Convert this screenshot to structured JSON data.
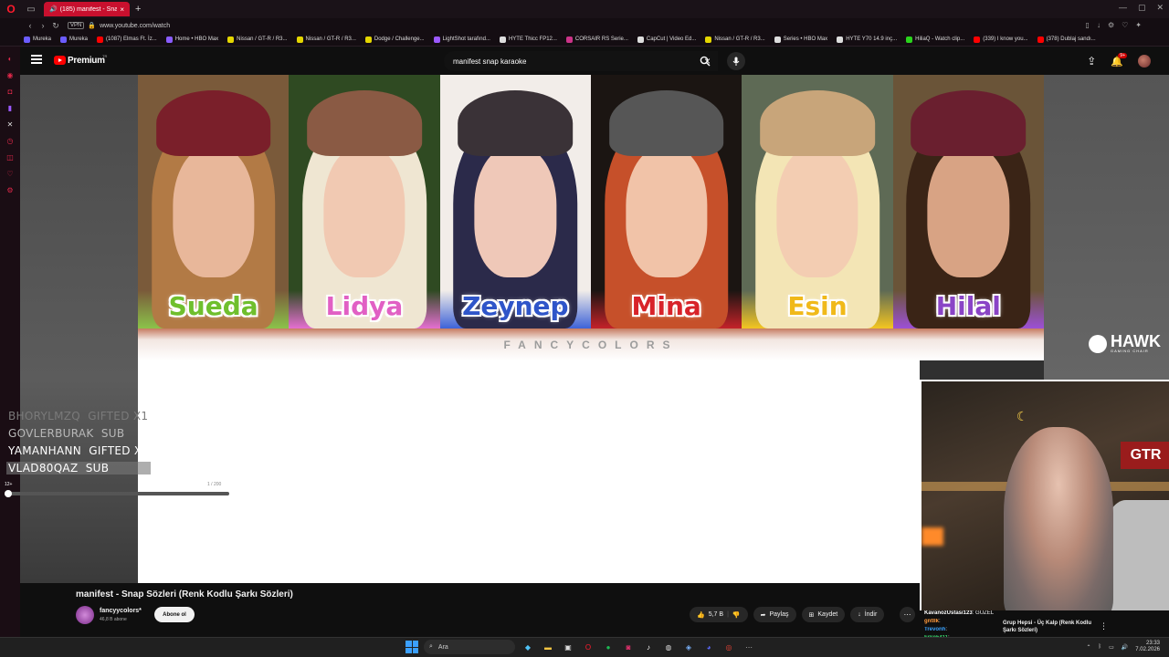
{
  "browser": {
    "tab_title": "(185) manifest - Snap",
    "vpn_label": "VPN",
    "url": "www.youtube.com/watch",
    "bookmarks": [
      {
        "label": "Mureka",
        "color": "#6b5cff"
      },
      {
        "label": "Mureka",
        "color": "#6b5cff"
      },
      {
        "label": "(1087) Elmas Ft. İz...",
        "color": "#ff0000"
      },
      {
        "label": "Home • HBO Max",
        "color": "#8a5cff"
      },
      {
        "label": "Nissan / GT-R / R3...",
        "color": "#e4d600"
      },
      {
        "label": "Nissan / GT-R / R3...",
        "color": "#e4d600"
      },
      {
        "label": "Dodge / Challenge...",
        "color": "#e4d600"
      },
      {
        "label": "LightShot tarafınd...",
        "color": "#9b59ff"
      },
      {
        "label": "HYTE Thicc FP12...",
        "color": "#dddddd"
      },
      {
        "label": "CORSAIR RS Serie...",
        "color": "#cc3388"
      },
      {
        "label": "CapCut | Video Ed...",
        "color": "#dddddd"
      },
      {
        "label": "Nissan / GT-R / R3...",
        "color": "#e4d600"
      },
      {
        "label": "Series • HBO Max",
        "color": "#dddddd"
      },
      {
        "label": "HYTE Y70 14.9 inç...",
        "color": "#dddddd"
      },
      {
        "label": "HiliaQ - Watch clip...",
        "color": "#2ad31c"
      },
      {
        "label": "(339) I know you...",
        "color": "#ff0000"
      },
      {
        "label": "(378) Dublaj sandı...",
        "color": "#ff0000"
      }
    ]
  },
  "youtube": {
    "brand": "Premium",
    "brand_sup": "TR",
    "search_value": "manifest snap karaoke",
    "notification_count": "9+"
  },
  "video": {
    "panels": [
      {
        "name": "Sueda",
        "name_color": "#6fbf2d",
        "bg": "#7a5a3a",
        "hat": "#7a1f2a",
        "hair": "#b27a45",
        "face": "#e8b79a",
        "band": "#8bc34a"
      },
      {
        "name": "Lidya",
        "name_color": "#e160c4",
        "bg": "#2f4a22",
        "hat": "#8a5a44",
        "hair": "#efe6d2",
        "face": "#f1c9b2",
        "band": "#e46fd0"
      },
      {
        "name": "Zeynep",
        "name_color": "#2f55c9",
        "bg": "#f2ede9",
        "hat": "#3a3237",
        "hair": "#2b2a4a",
        "face": "#efc8b8",
        "band": "#3e63d8"
      },
      {
        "name": "Mina",
        "name_color": "#d8232a",
        "bg": "#1b1512",
        "hat": "#565656",
        "hair": "#c6502a",
        "face": "#f1c3a8",
        "band": "#c42229"
      },
      {
        "name": "Esin",
        "name_color": "#f0b91a",
        "bg": "#5e6a55",
        "hat": "#c8a57a",
        "hair": "#f3e5b5",
        "face": "#f3cdb2",
        "band": "#f3c521"
      },
      {
        "name": "Hilal",
        "name_color": "#8a44c6",
        "bg": "#6a5438",
        "hat": "#6a1f2f",
        "hair": "#3a2416",
        "face": "#d8a384",
        "band": "#9c50d6"
      }
    ],
    "band_text": "FANCYCOLORS",
    "hawk_text": "HAWK",
    "hawk_sub": "GAMING CHAIR"
  },
  "alerts": [
    {
      "user": "BHORYLMZQ",
      "event": "GIFTED X1",
      "color": "#7a7a7a"
    },
    {
      "user": "GOVLERBURAK",
      "event": "SUB",
      "color": "#b8b8b8"
    },
    {
      "user": "YAMANHANN",
      "event": "GIFTED X1",
      "color": "#ffffff"
    },
    {
      "user": "VLAD80QAZ",
      "event": "SUB",
      "color": "#ffffff"
    }
  ],
  "goal": {
    "age_label": "12+",
    "count": "1 / 200",
    "progress": 0.005
  },
  "meta": {
    "title": "manifest - Snap Sözleri (Renk Kodlu Şarkı Sözleri)",
    "channel": "fancyycolors*",
    "subs": "46,8 B abone",
    "subscribe": "Abone ol",
    "likes": "5,7 B",
    "share": "Paylaş",
    "save": "Kaydet",
    "download": "İndir"
  },
  "chat": [
    {
      "user": "KavanozUstasi123",
      "msg": ": GÜZEL",
      "color": "#ffffff"
    },
    {
      "user": "gntllk",
      "msg": ":",
      "color": "#ff9a3d"
    },
    {
      "user": "Trevonh",
      "msg": ":",
      "color": "#3aa3ff"
    },
    {
      "user": "Frkn5411",
      "msg": ":",
      "color": "#37d46b"
    }
  ],
  "recommended": {
    "title": "Grup Hepsi - Üç Kalp (Renk Kodlu Şarkı Sözleri)"
  },
  "taskbar": {
    "search": "Ara",
    "time": "23:33",
    "date": "7.02.2026"
  }
}
